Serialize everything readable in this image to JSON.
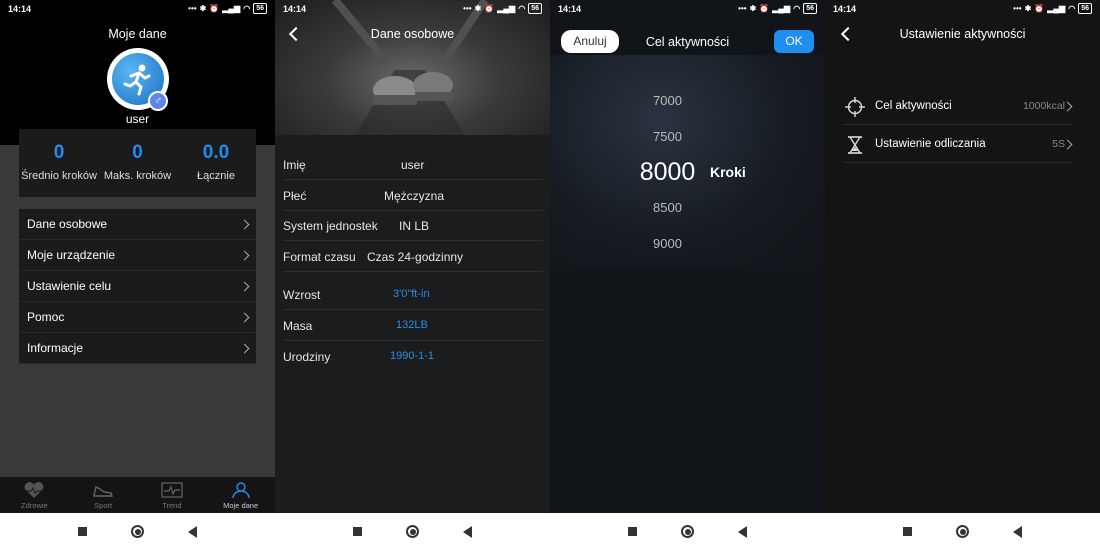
{
  "status": {
    "time": "14:14",
    "battery": "56"
  },
  "screen1": {
    "title": "Moje dane",
    "username": "user",
    "gender_symbol": "♂",
    "stats": [
      {
        "value": "0",
        "label": "Średnio kroków"
      },
      {
        "value": "0",
        "label": "Maks. kroków"
      },
      {
        "value": "0.0",
        "label": "Łącznie"
      }
    ],
    "menu": [
      {
        "label": "Dane osobowe"
      },
      {
        "label": "Moje urządzenie"
      },
      {
        "label": "Ustawienie celu"
      },
      {
        "label": "Pomoc"
      },
      {
        "label": "Informacje"
      }
    ],
    "tabs": [
      {
        "label": "Zdrowie",
        "icon": "heart-icon"
      },
      {
        "label": "Sport",
        "icon": "shoe-icon"
      },
      {
        "label": "Trend",
        "icon": "trend-icon"
      },
      {
        "label": "Moje dane",
        "icon": "person-icon",
        "active": true
      }
    ]
  },
  "screen2": {
    "title": "Dane osobowe",
    "rows": [
      {
        "key": "Imię",
        "value": "user",
        "blue": false
      },
      {
        "key": "Płeć",
        "value": "Mężczyzna",
        "blue": false
      },
      {
        "key": "System jednostek",
        "value": "IN LB",
        "blue": false
      },
      {
        "key": "Format czasu",
        "value": "Czas 24-godzinny",
        "blue": false
      },
      {
        "key": "Wzrost",
        "value": "3'0\"ft-in",
        "blue": true
      },
      {
        "key": "Masa",
        "value": "132LB",
        "blue": true
      },
      {
        "key": "Urodziny",
        "value": "1990-1-1",
        "blue": true
      }
    ]
  },
  "screen3": {
    "title": "Cel aktywności",
    "cancel_label": "Anuluj",
    "ok_label": "OK",
    "picker_values": [
      "7000",
      "7500",
      "8000",
      "8500",
      "9000"
    ],
    "selected_value": "8000",
    "unit": "Kroki"
  },
  "screen4": {
    "title": "Ustawienie aktywności",
    "rows": [
      {
        "label": "Cel aktywności",
        "value": "1000kcal",
        "icon": "target-icon"
      },
      {
        "label": "Ustawienie odliczania",
        "value": "5S",
        "icon": "hourglass-icon"
      }
    ]
  },
  "colors": {
    "accent": "#1e8ff0"
  }
}
